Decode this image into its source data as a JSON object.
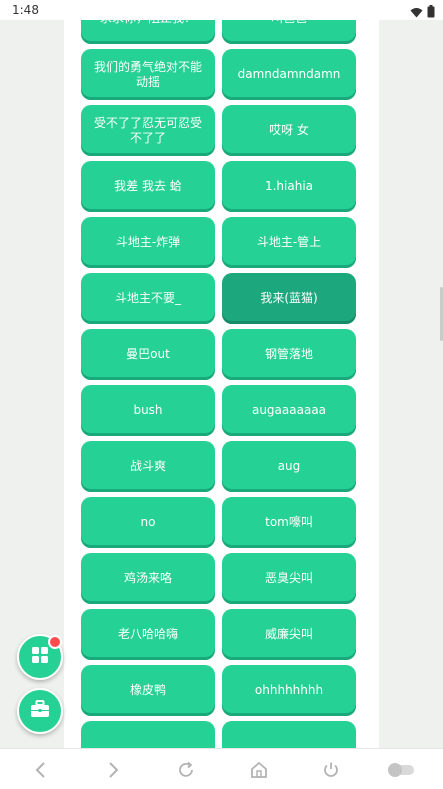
{
  "status": {
    "time": "1:48"
  },
  "buttons": [
    {
      "label": "求求你，阻止我！"
    },
    {
      "label": "叫爸爸"
    },
    {
      "label": "我们的勇气绝对不能动摇"
    },
    {
      "label": "damndamndamn"
    },
    {
      "label": "受不了了忍无可忍受不了了"
    },
    {
      "label": "哎呀 女"
    },
    {
      "label": "我差 我去 蛤"
    },
    {
      "label": "1.hiahia"
    },
    {
      "label": "斗地主-炸弹"
    },
    {
      "label": "斗地主-管上"
    },
    {
      "label": "斗地主不要_"
    },
    {
      "label": "我来(蓝猫)",
      "active": true
    },
    {
      "label": "曼巴out"
    },
    {
      "label": "钢管落地"
    },
    {
      "label": "bush"
    },
    {
      "label": "augaaaaaaa"
    },
    {
      "label": "战斗爽"
    },
    {
      "label": "aug"
    },
    {
      "label": "no"
    },
    {
      "label": "tom嚎叫"
    },
    {
      "label": "鸡汤来咯"
    },
    {
      "label": "恶臭尖叫"
    },
    {
      "label": "老八哈哈嗨"
    },
    {
      "label": "威廉尖叫"
    },
    {
      "label": "橡皮鸭"
    },
    {
      "label": "ohhhhhhhh"
    },
    {
      "label": ""
    },
    {
      "label": ""
    }
  ],
  "fabs": {
    "apps_icon": "grid-icon",
    "toolbox_icon": "toolbox-icon",
    "accent": "#25d195",
    "badge_color": "#ff4d4f"
  },
  "navbar": {
    "icons": [
      "back-icon",
      "forward-icon",
      "refresh-icon",
      "home-icon",
      "power-icon",
      "toggle-icon"
    ]
  }
}
